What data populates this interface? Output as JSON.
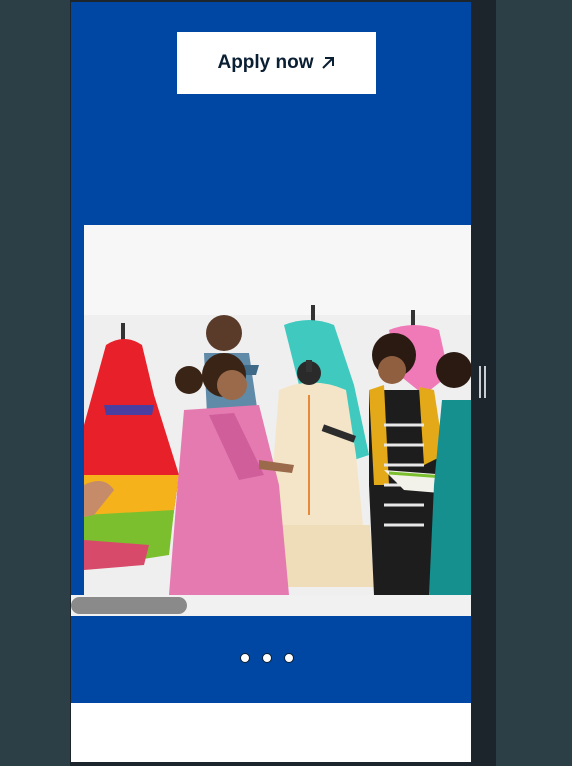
{
  "hero": {
    "background_color": "#0047a3",
    "apply_button": {
      "label": "Apply now",
      "icon": "arrow-up-right-icon"
    }
  },
  "carousel": {
    "image_description_icon": "fashion-design-students-photo",
    "dots": [
      {
        "active": false
      },
      {
        "active": false
      },
      {
        "active": false
      }
    ]
  },
  "scrollbar": {
    "thumb_color": "#8a8a8a",
    "track_color": "#f1f1f1"
  },
  "colors": {
    "brand_blue": "#0047a3",
    "page_background": "#2c3e46",
    "device_frame": "#1c252b"
  }
}
